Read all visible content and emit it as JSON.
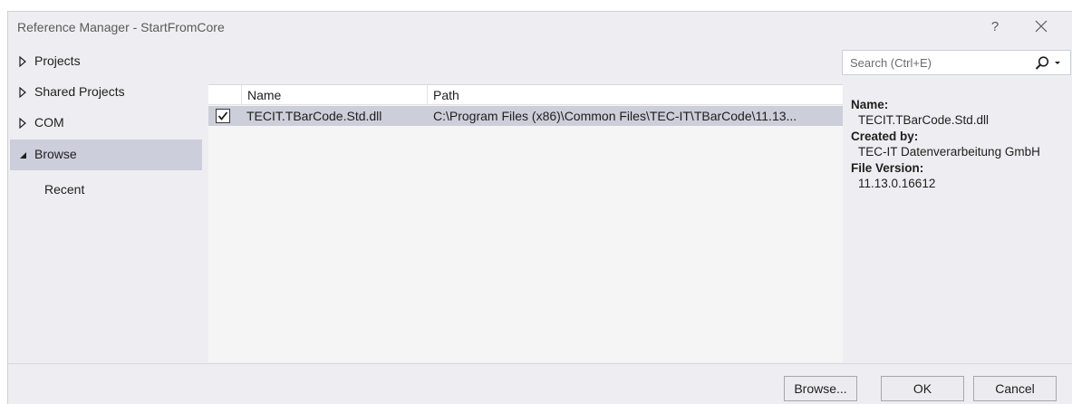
{
  "window": {
    "title": "Reference Manager - StartFromCore",
    "help_label": "?"
  },
  "nav": {
    "items": [
      {
        "label": "Projects",
        "state": "collapsed"
      },
      {
        "label": "Shared Projects",
        "state": "collapsed"
      },
      {
        "label": "COM",
        "state": "collapsed"
      },
      {
        "label": "Browse",
        "state": "expanded",
        "selected": true
      },
      {
        "label": "Recent",
        "state": "child"
      }
    ]
  },
  "search": {
    "placeholder": "Search (Ctrl+E)",
    "value": ""
  },
  "list": {
    "columns": [
      "Name",
      "Path"
    ],
    "rows": [
      {
        "checked": true,
        "name": "TECIT.TBarCode.Std.dll",
        "path": "C:\\Program Files (x86)\\Common Files\\TEC-IT\\TBarCode\\11.13..."
      }
    ]
  },
  "details": {
    "name_label": "Name:",
    "name_value": "TECIT.TBarCode.Std.dll",
    "created_label": "Created by:",
    "created_value": "TEC-IT Datenverarbeitung GmbH",
    "version_label": "File Version:",
    "version_value": "11.13.0.16612"
  },
  "footer": {
    "browse_label": "Browse...",
    "ok_label": "OK",
    "cancel_label": "Cancel"
  },
  "colors": {
    "selection": "#cccedb",
    "background": "#eeeef2"
  }
}
